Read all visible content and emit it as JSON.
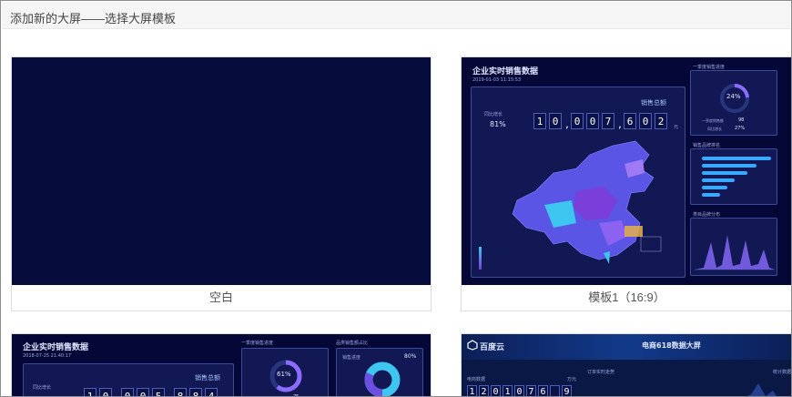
{
  "header": {
    "title": "添加新的大屏——选择大屏模板"
  },
  "cards": {
    "blank": {
      "label": "空白"
    },
    "template1": {
      "label": "模板1（16:9）",
      "preview": {
        "title": "企业实时销售数据",
        "datetime": "2019-01-03 11:15:53",
        "sales_total_label": "销售总额",
        "growth_label": "同比增长",
        "growth_value": "81%",
        "digits": [
          "1",
          "0",
          ",",
          "0",
          "0",
          "7",
          ",",
          "6",
          "0",
          "2"
        ],
        "unit": "元",
        "progress_title": "一季度销售进度",
        "progress_value": "24%",
        "progress_sub_label": "一季度销售额",
        "progress_sub_value": "98",
        "progress_yoy_label": "同比增长",
        "progress_yoy_value": "27%",
        "ranking_title": "销售品牌排名",
        "distribution_title": "类目品牌分布"
      }
    },
    "template2": {
      "preview": {
        "title": "企业实时销售数据",
        "datetime": "2018-07-25 21:40:17",
        "sales_total_label": "销售总额",
        "growth_label": "同比增长",
        "digits": [
          "1",
          "0",
          ",",
          "0",
          "0",
          "5",
          ",",
          "8",
          "8",
          "4"
        ],
        "progress_title": "一季度销售进度",
        "progress_value": "61%",
        "progress_sub_value": "75",
        "category_title": "品类销售额占比",
        "category_sub": "销售进度",
        "category_value": "80%"
      }
    },
    "template3": {
      "preview": {
        "brand": "百度云",
        "title": "电商618数据大屏",
        "left_label": "电商数据",
        "mid_label": "订单实时走势",
        "right_label": "统计数据",
        "digits": [
          "1",
          "2",
          "0",
          "1",
          "0",
          "7",
          "6",
          "",
          "9"
        ],
        "unit": "万元"
      }
    }
  },
  "colors": {
    "screen_bg": "#050836",
    "accent": "#3aa8ff",
    "panel_border": "#3a4b9a"
  }
}
